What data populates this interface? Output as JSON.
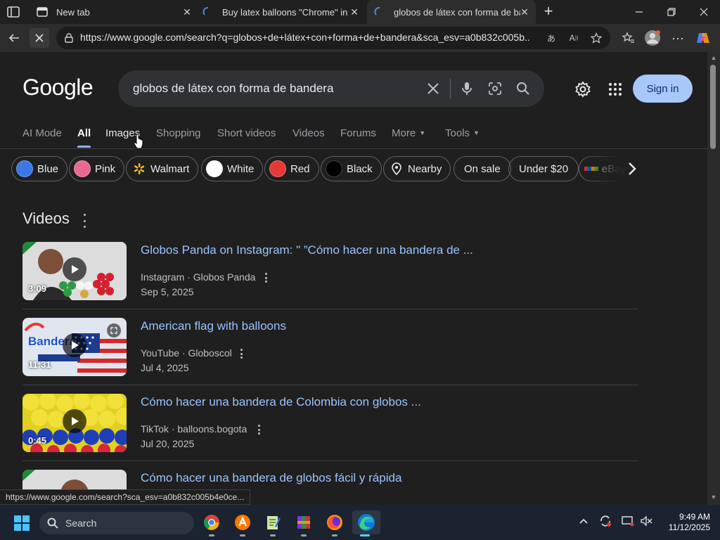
{
  "browser": {
    "tabs": [
      {
        "title": "New tab"
      },
      {
        "title": "Buy latex balloons \"Chrome\" in Ye"
      },
      {
        "title": "globos de látex con forma de ban"
      }
    ],
    "url": "https://www.google.com/search?q=globos+de+látex+con+forma+de+bandera&sca_esv=a0b832c005b...",
    "status_url": "https://www.google.com/search?sca_esv=a0b832c005b4e0ce..."
  },
  "google": {
    "logo": "Google",
    "query": "globos de látex con forma de bandera",
    "sign_in": "Sign in",
    "nav_tabs": [
      "AI Mode",
      "All",
      "Images",
      "Shopping",
      "Short videos",
      "Videos",
      "Forums",
      "More",
      "Tools"
    ],
    "chips": [
      {
        "label": "Blue",
        "color": "#3b78e7"
      },
      {
        "label": "Pink",
        "color": "#e86a8e"
      },
      {
        "label": "Walmart",
        "icon": "walmart-spark-icon"
      },
      {
        "label": "White",
        "color": "#ffffff"
      },
      {
        "label": "Red",
        "color": "#e53935"
      },
      {
        "label": "Black",
        "color": "#000000"
      },
      {
        "label": "Nearby",
        "icon": "location-pin-icon"
      },
      {
        "label": "On sale"
      },
      {
        "label": "Under $20"
      },
      {
        "label": "eBay",
        "icon": "ebay-icon"
      }
    ],
    "videos_heading": "Videos",
    "videos": [
      {
        "title": "Globos Panda on Instagram: \" ”Cómo hacer una bandera de ...",
        "source": "Instagram · Globos Panda",
        "date": "Sep 5, 2025",
        "duration": "3:09"
      },
      {
        "title": "American flag with balloons",
        "source": "YouTube · Globoscol",
        "date": "Jul 4, 2025",
        "duration": "11:31",
        "thumb_text": "Bandera"
      },
      {
        "title": "Cómo hacer una bandera de Colombia con globos ...",
        "source": "TikTok · balloons.bogota",
        "date": "Jul 20, 2025",
        "duration": "0:45"
      },
      {
        "title": "Cómo hacer una bandera de globos fácil y rápida"
      }
    ]
  },
  "taskbar": {
    "search_label": "Search",
    "time": "9:49 AM",
    "date": "11/12/2025"
  },
  "colors": {
    "link": "#99c3ff",
    "accent": "#8ab4f8",
    "signin_bg": "#a8c7fa"
  }
}
